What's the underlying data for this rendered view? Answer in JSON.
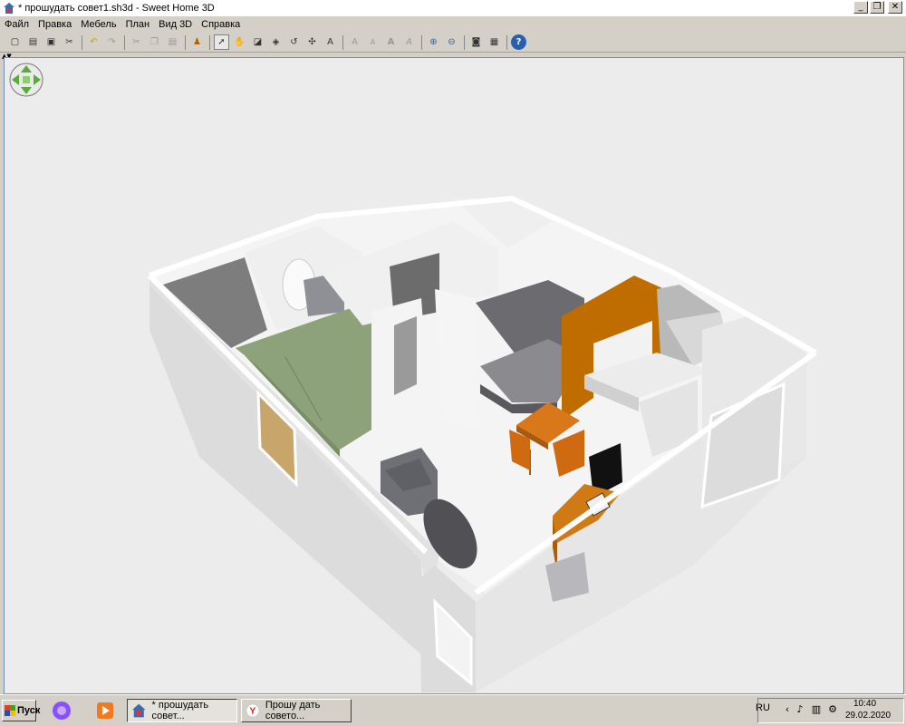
{
  "window": {
    "title": "* прошудать совет1.sh3d - Sweet Home 3D",
    "minimize_glyph": "_",
    "maximize_glyph": "❐",
    "close_glyph": "✕"
  },
  "menu": {
    "items": [
      "Файл",
      "Правка",
      "Мебель",
      "План",
      "Вид 3D",
      "Справка"
    ]
  },
  "toolbar": {
    "buttons": [
      {
        "icon": "new-file-icon",
        "glyph": "▢"
      },
      {
        "icon": "open-folder-icon",
        "glyph": "▤"
      },
      {
        "icon": "save-icon",
        "glyph": "▣"
      },
      {
        "icon": "preferences-icon",
        "glyph": "✂"
      },
      {
        "icon": "undo-icon",
        "glyph": "↶"
      },
      {
        "icon": "redo-icon",
        "glyph": "↷"
      },
      {
        "icon": "cut-icon",
        "glyph": "✂"
      },
      {
        "icon": "copy-icon",
        "glyph": "❐"
      },
      {
        "icon": "paste-icon",
        "glyph": "▤"
      },
      {
        "icon": "add-furniture-icon",
        "glyph": "♟"
      },
      {
        "icon": "select-arrow-icon",
        "glyph": "➚"
      },
      {
        "icon": "pan-hand-icon",
        "glyph": "✋"
      },
      {
        "icon": "create-walls-icon",
        "glyph": "◪"
      },
      {
        "icon": "create-rooms-icon",
        "glyph": "◈"
      },
      {
        "icon": "create-polylines-icon",
        "glyph": "↺"
      },
      {
        "icon": "create-dimensions-icon",
        "glyph": "✣"
      },
      {
        "icon": "add-text-icon",
        "glyph": "A"
      },
      {
        "icon": "increase-text-icon",
        "glyph": "A"
      },
      {
        "icon": "decrease-text-icon",
        "glyph": "A"
      },
      {
        "icon": "bold-text-icon",
        "glyph": "A"
      },
      {
        "icon": "italic-text-icon",
        "glyph": "A"
      },
      {
        "icon": "zoom-in-icon",
        "glyph": "⊕"
      },
      {
        "icon": "zoom-out-icon",
        "glyph": "⊖"
      },
      {
        "icon": "create-photo-icon",
        "glyph": "◙"
      },
      {
        "icon": "create-video-icon",
        "glyph": "▦"
      },
      {
        "icon": "help-icon",
        "glyph": "?"
      }
    ]
  },
  "taskbar": {
    "start_label": "Пуск",
    "tasks": [
      {
        "label": "* прошудать совет...",
        "icon": "sweet-home-3d-icon",
        "active": true
      },
      {
        "label": "Прошу дать совето...",
        "icon": "yandex-browser-icon",
        "active": false
      }
    ],
    "language": "RU",
    "time": "10:40",
    "date": "29.02.2020"
  }
}
